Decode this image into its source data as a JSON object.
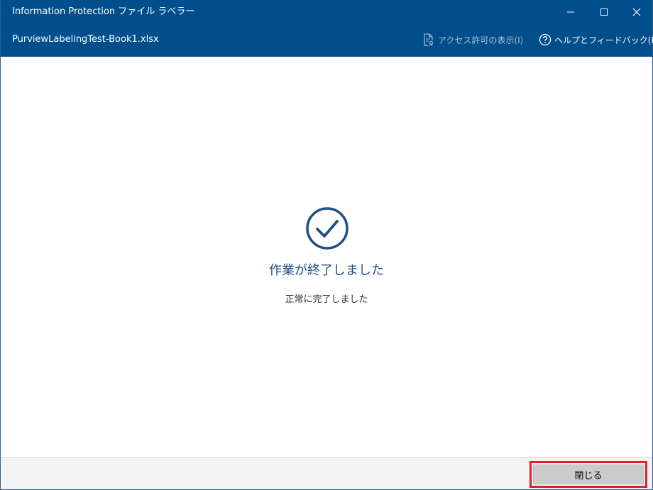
{
  "window": {
    "title": "Information Protection ファイル ラベラー",
    "file_name": "PurviewLabelingTest-Book1.xlsx"
  },
  "header_links": {
    "access_label": "アクセス許可の表示(I)",
    "help_label": "ヘルプとフィードバック(H)"
  },
  "result": {
    "title": "作業が終了しました",
    "message": "正常に完了しました"
  },
  "footer": {
    "close_label": "閉じる"
  },
  "colors": {
    "header_bg": "#004e8c",
    "accent": "#1f4f85",
    "highlight_border": "#e0202a"
  },
  "icons": {
    "minimize": "minimize-icon",
    "maximize": "maximize-icon",
    "close": "close-icon",
    "access": "document-permission-icon",
    "help": "help-circle-icon",
    "status": "check-circle-icon"
  }
}
